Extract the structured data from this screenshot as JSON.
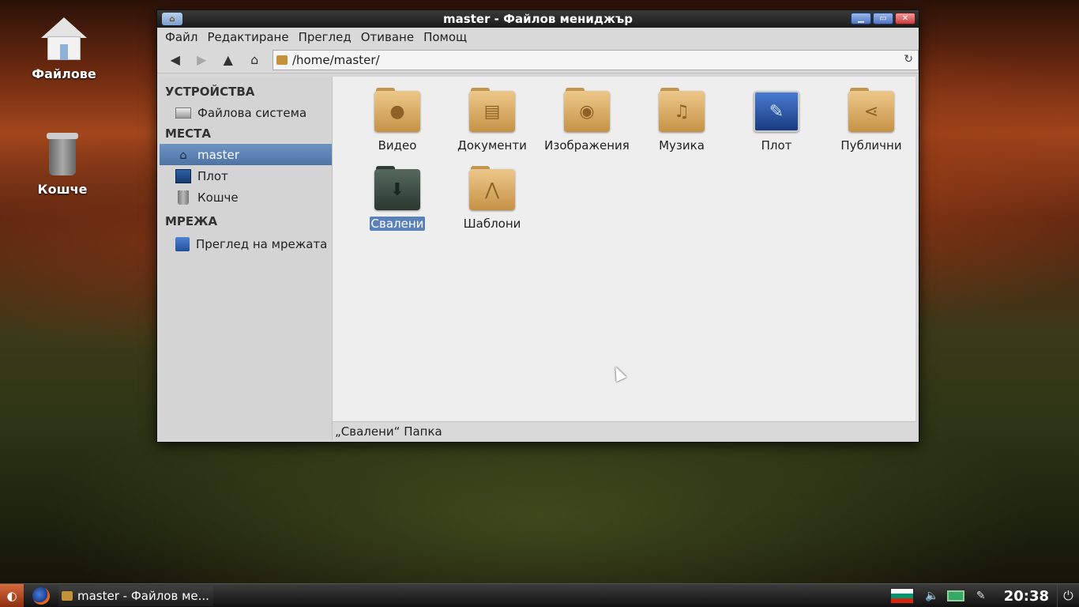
{
  "desktop": {
    "icons": [
      {
        "label": "Файлове"
      },
      {
        "label": "Кошче"
      }
    ]
  },
  "window": {
    "title": "master - Файлов мениджър",
    "buttons": {
      "minimize": "▁",
      "maximize": "▭",
      "close": "✕"
    }
  },
  "menubar": {
    "items": [
      "Файл",
      "Редактиране",
      "Преглед",
      "Отиване",
      "Помощ"
    ]
  },
  "toolbar": {
    "back": "◀",
    "forward": "▶",
    "up": "▲",
    "home": "⌂",
    "location": "/home/master/",
    "reload": "↻"
  },
  "sidebar": {
    "sections": [
      {
        "title": "УСТРОЙСТВА",
        "items": [
          {
            "label": "Файлова система",
            "icon": "drive-icon"
          }
        ]
      },
      {
        "title": "МЕСТА",
        "items": [
          {
            "label": "master",
            "icon": "home-icon",
            "selected": true
          },
          {
            "label": "Плот",
            "icon": "desktop-icon"
          },
          {
            "label": "Кошче",
            "icon": "trash-icon"
          }
        ]
      },
      {
        "title": "МРЕЖА",
        "items": [
          {
            "label": "Преглед на мрежата",
            "icon": "network-icon"
          }
        ]
      }
    ]
  },
  "files": [
    {
      "label": "Видео",
      "icon": "video-folder-icon",
      "glyph": "●"
    },
    {
      "label": "Документи",
      "icon": "documents-folder-icon",
      "glyph": "▤"
    },
    {
      "label": "Изображения",
      "icon": "pictures-folder-icon",
      "glyph": "◉"
    },
    {
      "label": "Музика",
      "icon": "music-folder-icon",
      "glyph": "♫"
    },
    {
      "label": "Плот",
      "icon": "desktop-file-icon",
      "glyph": "✎"
    },
    {
      "label": "Публични",
      "icon": "public-folder-icon",
      "glyph": "⋖"
    },
    {
      "label": "Свалени",
      "icon": "downloads-folder-icon",
      "glyph": "⬇",
      "selected": true
    },
    {
      "label": "Шаблони",
      "icon": "templates-folder-icon",
      "glyph": "⋀"
    }
  ],
  "statusbar": {
    "text": "„Свалени“ Папка"
  },
  "taskbar": {
    "start": "◐",
    "task_label": "master - Файлов ме...",
    "volume": "🔈",
    "pen": "✎",
    "clock": "20:38",
    "power": "⏻",
    "flag_colors": [
      "#ffffff",
      "#00966e",
      "#d62612"
    ]
  }
}
